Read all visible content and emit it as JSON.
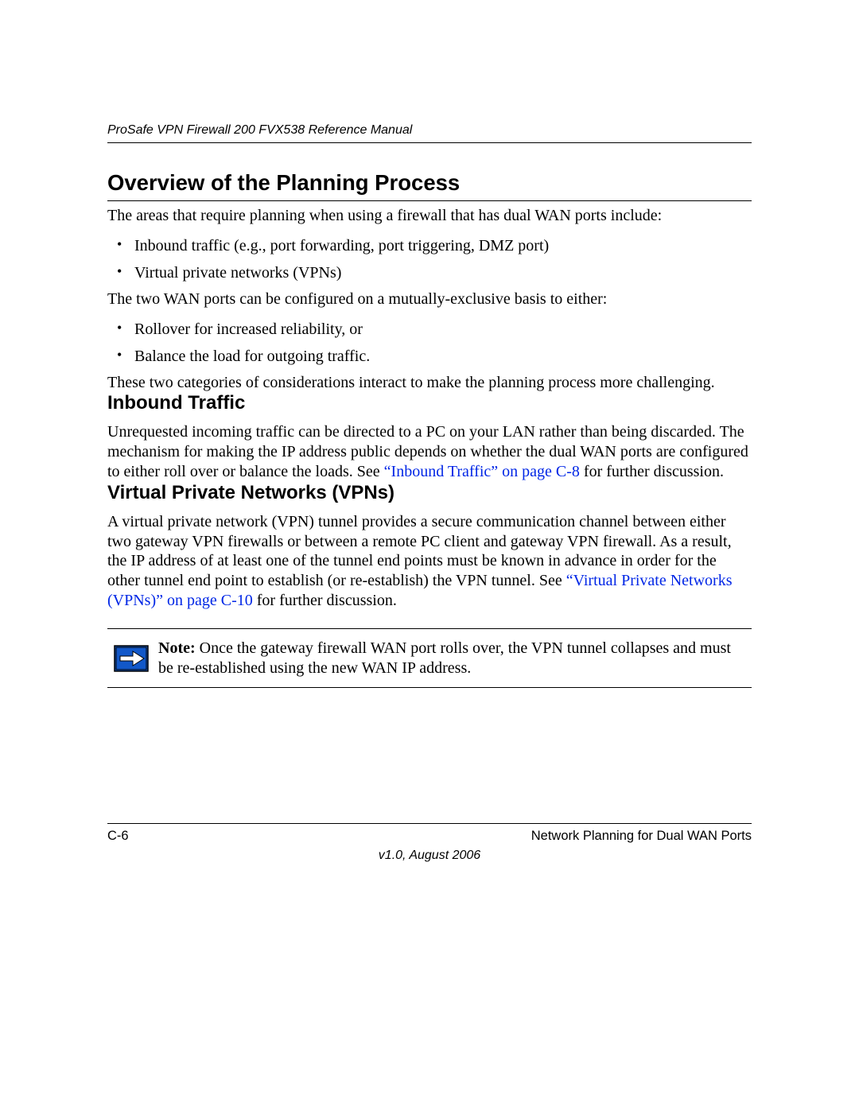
{
  "doc": {
    "running_header": "ProSafe VPN Firewall 200 FVX538 Reference Manual",
    "title": "Overview of the Planning Process",
    "intro": "The areas that require planning when using a firewall that has dual WAN ports include:",
    "bullets1": [
      "Inbound traffic (e.g., port forwarding, port triggering, DMZ port)",
      "Virtual private networks (VPNs)"
    ],
    "mid1": "The two WAN ports can be configured on a mutually-exclusive basis to either:",
    "bullets2": [
      "Rollover for increased reliability, or",
      "Balance the load for outgoing traffic."
    ],
    "mid2": "These two categories of considerations interact to make the planning process more challenging.",
    "sub1_title": "Inbound Traffic",
    "sub1_para_pre": "Unrequested incoming traffic can be directed to a PC on your LAN rather than being discarded. The mechanism for making the IP address public depends on whether the dual WAN ports are configured to either roll over or balance the loads. See ",
    "sub1_link": "“Inbound Traffic” on page C-8",
    "sub1_para_post": " for further discussion.",
    "sub2_title": "Virtual Private Networks (VPNs)",
    "sub2_para_pre": "A virtual private network (VPN) tunnel provides a secure communication channel between either two gateway VPN firewalls or between a remote PC client and gateway VPN firewall. As a result, the IP address of at least one of the tunnel end points must be known in advance in order for the other tunnel end point to establish (or re-establish) the VPN tunnel. See ",
    "sub2_link": "“Virtual Private Networks (VPNs)” on page C-10",
    "sub2_para_post": " for further discussion.",
    "note_label": "Note:",
    "note_body": " Once the gateway firewall WAN port rolls over, the VPN tunnel collapses and must be re-established using the new WAN IP address.",
    "footer_left": "C-6",
    "footer_right": "Network Planning for Dual WAN Ports",
    "footer_version": "v1.0, August 2006"
  }
}
